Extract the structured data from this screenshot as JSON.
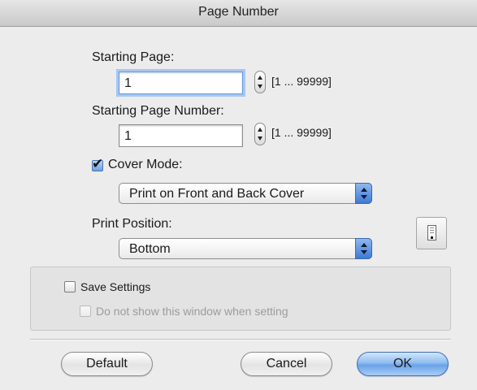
{
  "window": {
    "title": "Page Number"
  },
  "starting_page": {
    "label": "Starting Page:",
    "value": "1",
    "range": "[1 ... 99999]"
  },
  "starting_page_number": {
    "label": "Starting Page Number:",
    "value": "1",
    "range": "[1 ... 99999]"
  },
  "cover_mode": {
    "label": "Cover Mode:",
    "checked": true,
    "selected": "Print on Front and Back Cover"
  },
  "print_position": {
    "label": "Print Position:",
    "selected": "Bottom",
    "preview_icon": "page-position-icon"
  },
  "settings": {
    "save_label": "Save Settings",
    "save_checked": false,
    "dont_show_label": "Do not show this window when setting",
    "dont_show_checked": false
  },
  "buttons": {
    "default": "Default",
    "cancel": "Cancel",
    "ok": "OK"
  },
  "colors": {
    "accent": "#6aa3e8",
    "focus_ring": "#a7c7f3"
  }
}
